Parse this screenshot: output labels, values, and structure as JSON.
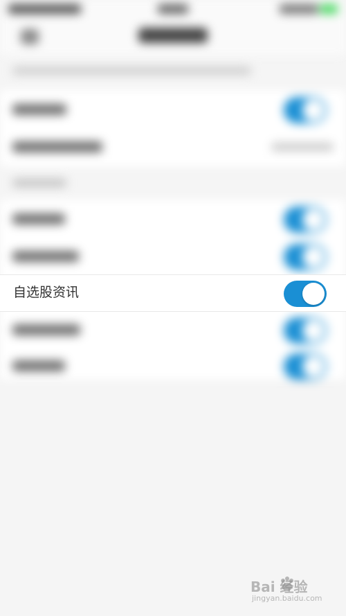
{
  "setting_row": {
    "label": "自选股资讯",
    "enabled": true
  },
  "watermark": {
    "mark": "Bai 经验",
    "url": "jingyan.baidu.com"
  },
  "colors": {
    "toggle_on": "#1a8fd4",
    "background": "#f5f5f5",
    "row_background": "#ffffff",
    "label_text": "#333333"
  },
  "icons": {
    "watermark_logo": "paw-icon"
  }
}
